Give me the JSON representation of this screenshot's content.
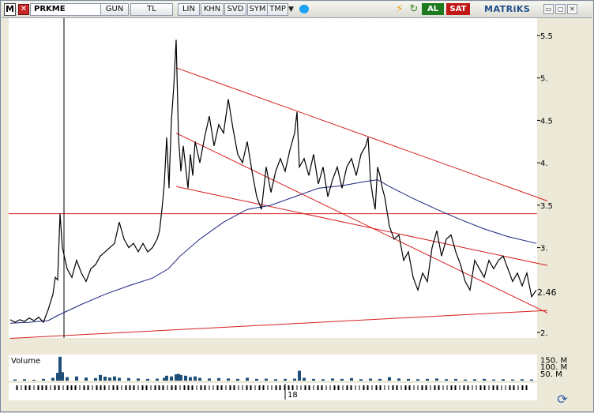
{
  "toolbar": {
    "symbol": "PRKME",
    "period": "GUN",
    "currency": "TL",
    "lin": "LIN",
    "khn": "KHN",
    "svd": "SVD",
    "sym": "SYM",
    "tmp": "TMP",
    "menu_glyph": "▼",
    "buy": "AL",
    "sell": "SAT",
    "brand": "MATRiKS"
  },
  "icons": {
    "app": "M",
    "close": "✕",
    "twitter": "twitter-icon",
    "bolt": "lightning-icon",
    "refresh": "refresh-icon",
    "window_buttons": [
      "▭",
      "▢",
      "✕"
    ]
  },
  "colors": {
    "price": "#000000",
    "moving_average": "#1a237e",
    "trend_lines": "#d62020",
    "volume": "#1f4e79",
    "buy": "#1e7a1e",
    "sell": "#c01818"
  },
  "chart_data": {
    "type": "line",
    "y_axis": {
      "ticks": [
        "5.5",
        "5.",
        "4.5",
        "4.",
        "3.5",
        "3.",
        "2."
      ],
      "ylim": [
        1.86,
        5.61
      ],
      "position": "right"
    },
    "last_value": "2.46",
    "x_axis": {
      "ticks": [
        "18"
      ]
    },
    "series": [
      {
        "name": "",
        "x": [
          0,
          6,
          12,
          18,
          24,
          30,
          36,
          42,
          48,
          54,
          57,
          60,
          63,
          66,
          72,
          78,
          84,
          90,
          96,
          102,
          108,
          114,
          120,
          126,
          132,
          138,
          144,
          150,
          156,
          162,
          168,
          174,
          180,
          186,
          189,
          192,
          195,
          198,
          201,
          202,
          204,
          207,
          210,
          213,
          216,
          219,
          222,
          225,
          228,
          231,
          234,
          240,
          246,
          252,
          258,
          264,
          270,
          276,
          282,
          288,
          294,
          300,
          306,
          312,
          318,
          324,
          330,
          336,
          342,
          348,
          354,
          360,
          363,
          366,
          372,
          378,
          384,
          390,
          396,
          402,
          408,
          414,
          420,
          426,
          432,
          438,
          444,
          450,
          453,
          456,
          459,
          462,
          465,
          468,
          471,
          474,
          480,
          486,
          492,
          498,
          504,
          510,
          516,
          522,
          528,
          534,
          540,
          546,
          552,
          558,
          564,
          570,
          576,
          582,
          588,
          594,
          600,
          606,
          612,
          618,
          624,
          630,
          636,
          642,
          648,
          654,
          660,
          666
        ],
        "values": [
          2.15,
          2.12,
          2.15,
          2.13,
          2.17,
          2.14,
          2.18,
          2.12,
          2.27,
          2.45,
          2.65,
          2.62,
          3.4,
          3.0,
          2.75,
          2.65,
          2.85,
          2.7,
          2.6,
          2.75,
          2.8,
          2.9,
          2.95,
          3.0,
          3.05,
          3.3,
          3.1,
          3.0,
          3.05,
          2.95,
          3.05,
          2.95,
          3.0,
          3.1,
          3.2,
          3.45,
          3.75,
          4.3,
          3.7,
          4.0,
          4.5,
          4.9,
          5.45,
          4.3,
          3.9,
          4.2,
          3.95,
          3.7,
          4.1,
          3.85,
          4.25,
          4.0,
          4.3,
          4.55,
          4.2,
          4.45,
          4.35,
          4.75,
          4.4,
          4.1,
          4.0,
          4.25,
          3.9,
          3.6,
          3.45,
          3.95,
          3.65,
          3.9,
          4.05,
          3.9,
          4.15,
          4.35,
          4.6,
          3.95,
          4.05,
          3.85,
          4.1,
          3.75,
          3.95,
          3.6,
          3.8,
          3.95,
          3.7,
          3.95,
          4.05,
          3.85,
          4.1,
          4.2,
          4.3,
          3.8,
          3.6,
          3.45,
          3.95,
          3.85,
          3.7,
          3.6,
          3.25,
          3.1,
          3.15,
          2.85,
          2.95,
          2.65,
          2.5,
          2.7,
          2.6,
          3.0,
          3.2,
          2.9,
          3.1,
          3.15,
          2.95,
          2.8,
          2.6,
          2.5,
          2.85,
          2.75,
          2.65,
          2.85,
          2.75,
          2.85,
          2.9,
          2.75,
          2.6,
          2.7,
          2.55,
          2.7,
          2.42,
          2.5
        ]
      },
      {
        "name": "",
        "x": [
          0,
          24,
          48,
          60,
          90,
          120,
          150,
          180,
          200,
          215,
          240,
          270,
          300,
          330,
          360,
          390,
          420,
          450,
          465,
          480,
          510,
          540,
          570,
          600,
          630,
          666
        ],
        "values": [
          2.11,
          2.12,
          2.14,
          2.2,
          2.33,
          2.45,
          2.55,
          2.64,
          2.75,
          2.9,
          3.1,
          3.3,
          3.45,
          3.5,
          3.6,
          3.7,
          3.73,
          3.78,
          3.8,
          3.72,
          3.58,
          3.45,
          3.33,
          3.22,
          3.13,
          3.05
        ]
      },
      {
        "name": "Volume",
        "axis_ticks": [
          "150. M",
          "100. M",
          "50. M"
        ],
        "ylim": [
          0,
          180
        ],
        "x": [
          6,
          18,
          30,
          42,
          54,
          60,
          63,
          66,
          72,
          84,
          96,
          108,
          114,
          120,
          126,
          132,
          138,
          150,
          162,
          174,
          186,
          195,
          198,
          204,
          210,
          213,
          216,
          222,
          228,
          234,
          240,
          252,
          264,
          276,
          288,
          300,
          312,
          324,
          336,
          348,
          360,
          366,
          372,
          384,
          396,
          408,
          420,
          432,
          444,
          456,
          468,
          480,
          492,
          504,
          516,
          528,
          540,
          552,
          564,
          576,
          588,
          600,
          612,
          624,
          636,
          648,
          660
        ],
        "values": [
          8,
          10,
          6,
          12,
          20,
          55,
          170,
          60,
          25,
          30,
          22,
          18,
          40,
          28,
          22,
          30,
          20,
          18,
          15,
          12,
          14,
          20,
          35,
          30,
          45,
          48,
          40,
          35,
          25,
          30,
          20,
          15,
          18,
          15,
          12,
          20,
          12,
          14,
          10,
          12,
          14,
          70,
          20,
          12,
          10,
          15,
          12,
          18,
          10,
          14,
          12,
          25,
          15,
          12,
          10,
          12,
          15,
          10,
          12,
          8,
          10,
          12,
          8,
          10,
          8,
          10,
          8
        ]
      }
    ],
    "reference_lines": [
      {
        "type": "horizontal",
        "value": 3.4
      },
      {
        "type": "trend",
        "x": [
          210,
          680
        ],
        "values": [
          5.12,
          3.55
        ]
      },
      {
        "type": "trend",
        "x": [
          210,
          680
        ],
        "values": [
          4.35,
          2.23
        ]
      },
      {
        "type": "trend",
        "x": [
          210,
          680
        ],
        "values": [
          3.72,
          2.79
        ]
      },
      {
        "type": "trend",
        "x": [
          0,
          680
        ],
        "values": [
          1.93,
          2.26
        ]
      },
      {
        "type": "vertical",
        "x": 68
      }
    ],
    "legend": "none",
    "grid": false
  }
}
